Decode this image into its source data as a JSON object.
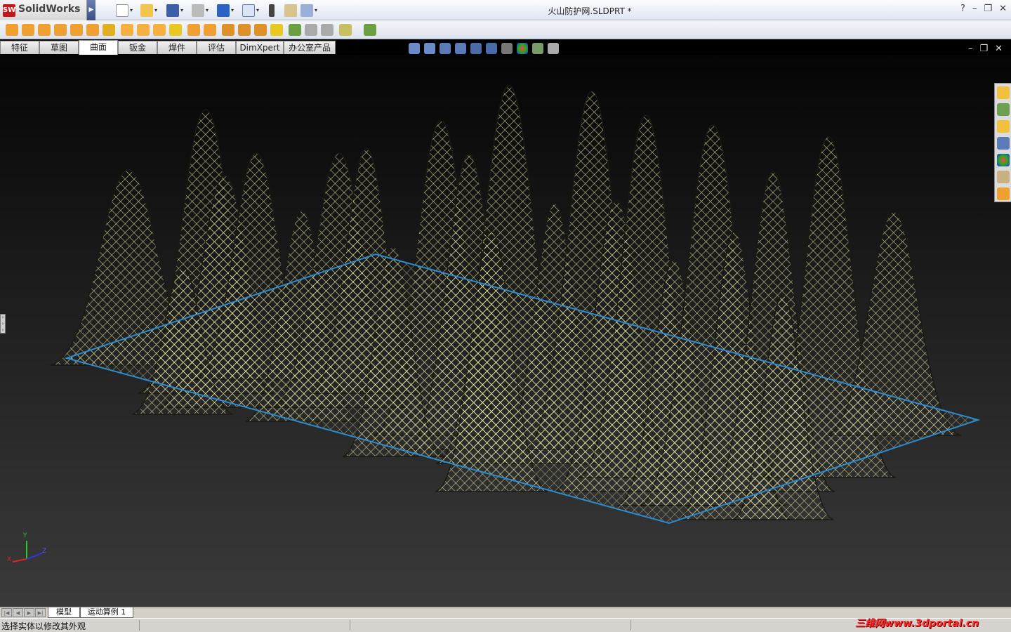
{
  "app": {
    "name": "SolidWorks",
    "logo_letter": "SW",
    "document_title": "火山防护网.SLDPRT *"
  },
  "window_buttons": {
    "help": "?",
    "minimize": "–",
    "restore": "❐",
    "close": "✕"
  },
  "tabs": [
    {
      "label": "特征"
    },
    {
      "label": "草图"
    },
    {
      "label": "曲面"
    },
    {
      "label": "钣金"
    },
    {
      "label": "焊件"
    },
    {
      "label": "评估"
    },
    {
      "label": "DimXpert"
    },
    {
      "label": "办公室产品"
    }
  ],
  "bottom_tabs": [
    {
      "label": "模型"
    },
    {
      "label": "运动算例 1"
    }
  ],
  "status": {
    "message": "选择实体以修改其外观"
  },
  "watermark": {
    "text": "三维网www.3dportal.cn"
  },
  "triad": {
    "x": "X",
    "y": "Y",
    "z": "Z"
  },
  "colors": {
    "mesh": "#e8e7a4",
    "mesh_dark": "#1a1a12",
    "plane_edge": "#2a8cd0",
    "accent_red": "#c4161c",
    "background_top": "#050505",
    "background_bottom": "#3a3a3a"
  }
}
